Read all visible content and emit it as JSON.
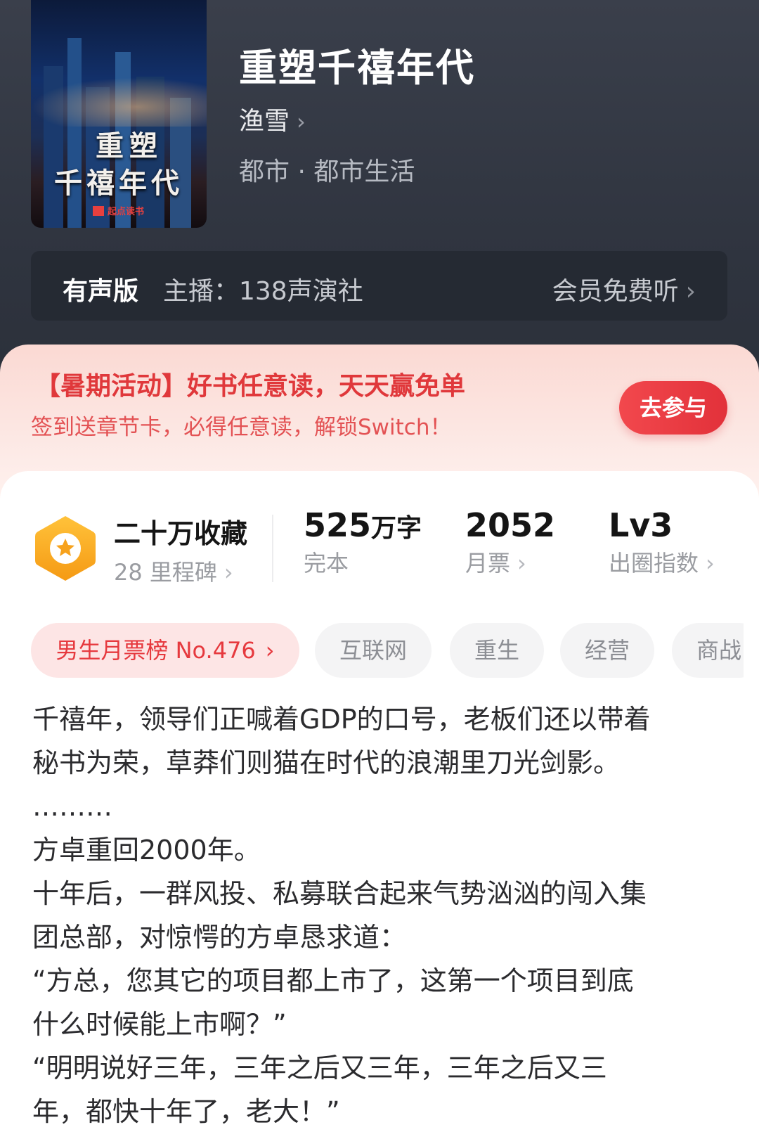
{
  "book": {
    "cover_title_line1": "重塑",
    "cover_title_line2": "千禧年代",
    "cover_publisher": "起点读书",
    "title": "重塑千禧年代",
    "author": "渔雪",
    "genre": "都市 · 都市生活"
  },
  "audio": {
    "label": "有声版",
    "host": "主播：138声演社",
    "vip_listen": "会员免费听"
  },
  "promo": {
    "headline": "【暑期活动】好书任意读，天天赢免单",
    "subline": "签到送章节卡，必得任意读，解锁Switch！",
    "button": "去参与"
  },
  "stats": {
    "favorites": "二十万收藏",
    "milestones": "28 里程碑",
    "words_num": "525",
    "words_unit": "万字",
    "status": "完本",
    "monthly_tickets": "2052",
    "monthly_label": "月票",
    "level": "Lv3",
    "level_label": "出圈指数"
  },
  "tags": [
    {
      "label": "男生月票榜 No.476"
    },
    {
      "label": "互联网"
    },
    {
      "label": "重生"
    },
    {
      "label": "经营"
    },
    {
      "label": "商战"
    }
  ],
  "description": [
    "千禧年，领导们正喊着GDP的口号，老板们还以带着",
    "秘书为荣，草莽们则猫在时代的浪潮里刀光剑影。",
    "………",
    "方卓重回2000年。",
    "十年后，一群风投、私募联合起来气势汹汹的闯入集",
    "团总部，对惊愕的方卓恳求道：",
    "“方总，您其它的项目都上市了，这第一个项目到底",
    "什么时候能上市啊？”",
    "“明明说好三年，三年之后又三年，三年之后又三",
    "年，都快十年了，老大！”"
  ],
  "colors": {
    "accent_red": "#e0383b",
    "badge_orange": "#f7a21c",
    "header_bg": "#363b46"
  },
  "icons": [
    "book-cover-image",
    "chevron-right-icon",
    "star-badge-icon"
  ]
}
